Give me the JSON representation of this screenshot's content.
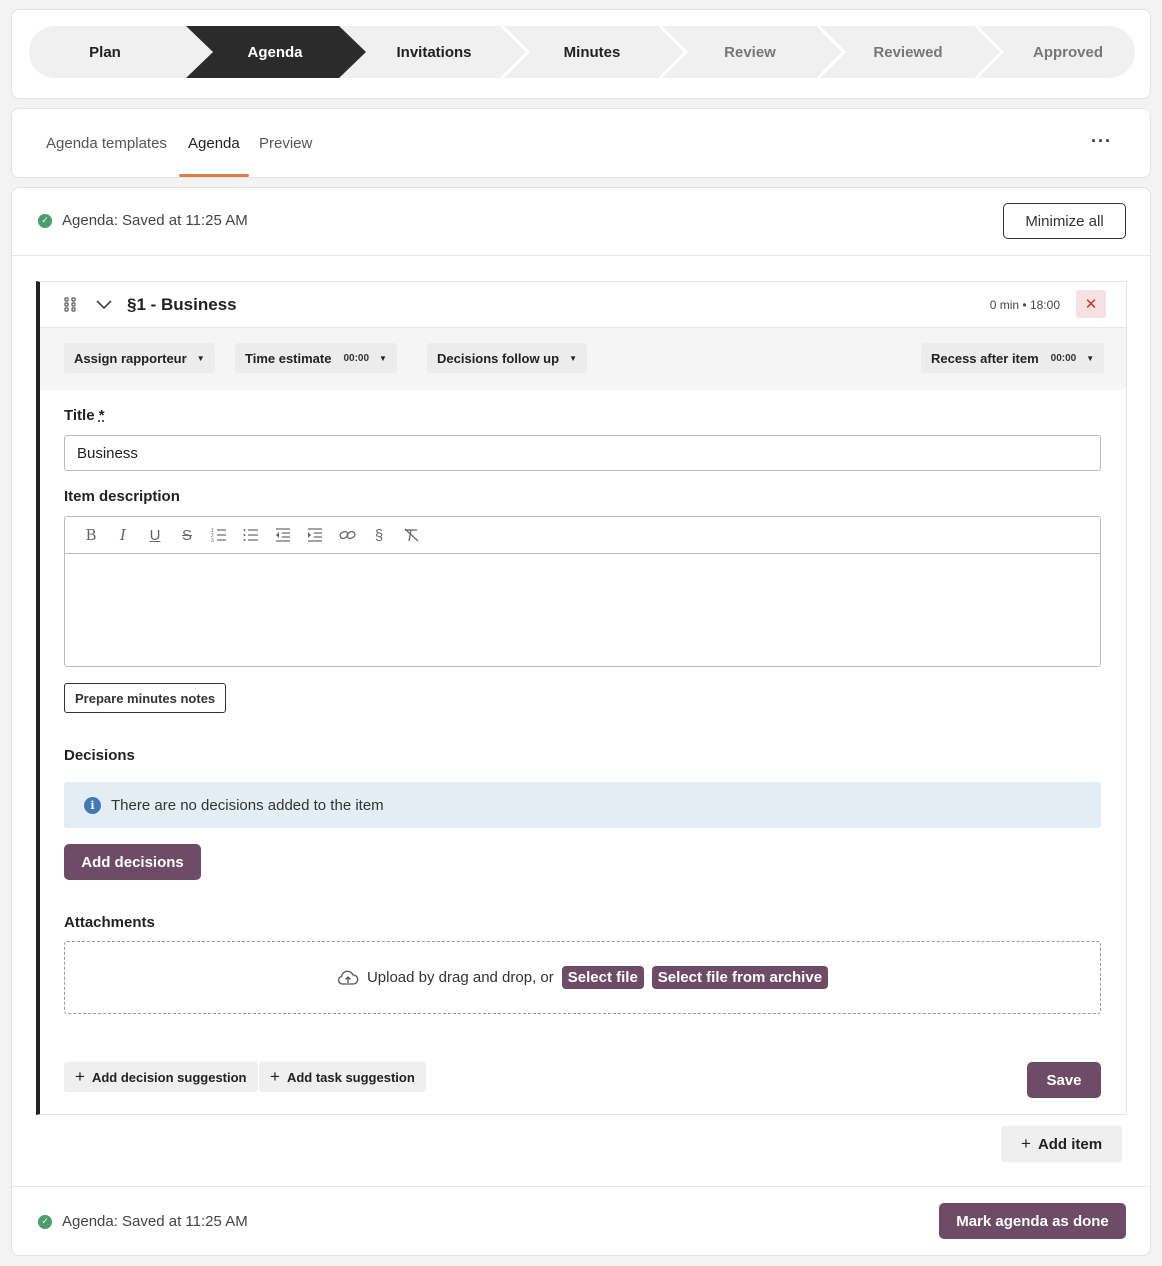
{
  "stepper": {
    "steps": [
      {
        "label": "Plan"
      },
      {
        "label": "Agenda"
      },
      {
        "label": "Invitations"
      },
      {
        "label": "Minutes"
      },
      {
        "label": "Review"
      },
      {
        "label": "Reviewed"
      },
      {
        "label": "Approved"
      }
    ]
  },
  "tabs": {
    "items": [
      {
        "label": "Agenda templates"
      },
      {
        "label": "Agenda"
      },
      {
        "label": "Preview"
      }
    ],
    "more_label": "···"
  },
  "status": {
    "top_text": "Agenda: Saved at 11:25 AM",
    "bottom_text": "Agenda: Saved at 11:25 AM"
  },
  "header": {
    "minimize_label": "Minimize all"
  },
  "item": {
    "heading": "§1 - Business",
    "meta": "0 min • 18:00",
    "close_label": "✕",
    "toolbar": {
      "assign_label": "Assign rapporteur",
      "time_label": "Time estimate",
      "time_value": "00:00",
      "decisions_follow_label": "Decisions follow up",
      "recess_label": "Recess after item",
      "recess_value": "00:00"
    },
    "title_label": "Title",
    "title_required": "*",
    "title_value": "Business",
    "description_label": "Item description",
    "prepare_minutes_label": "Prepare minutes notes",
    "decisions_label": "Decisions",
    "no_decisions_text": "There are no decisions added to the item",
    "add_decisions_label": "Add decisions",
    "attachments_label": "Attachments",
    "upload_text": "Upload by drag and drop, or",
    "select_file_label": "Select file",
    "select_archive_label": "Select file from archive",
    "add_decision_suggestion_label": "Add decision suggestion",
    "add_task_suggestion_label": "Add task suggestion",
    "save_label": "Save"
  },
  "footer": {
    "add_item_label": "Add item",
    "mark_done_label": "Mark agenda as done"
  },
  "colors": {
    "primary": "#6e4b66",
    "active_step": "#2b2b2b",
    "tab_underline": "#e07b45",
    "success": "#4a9e6b",
    "info": "#4178b5"
  }
}
